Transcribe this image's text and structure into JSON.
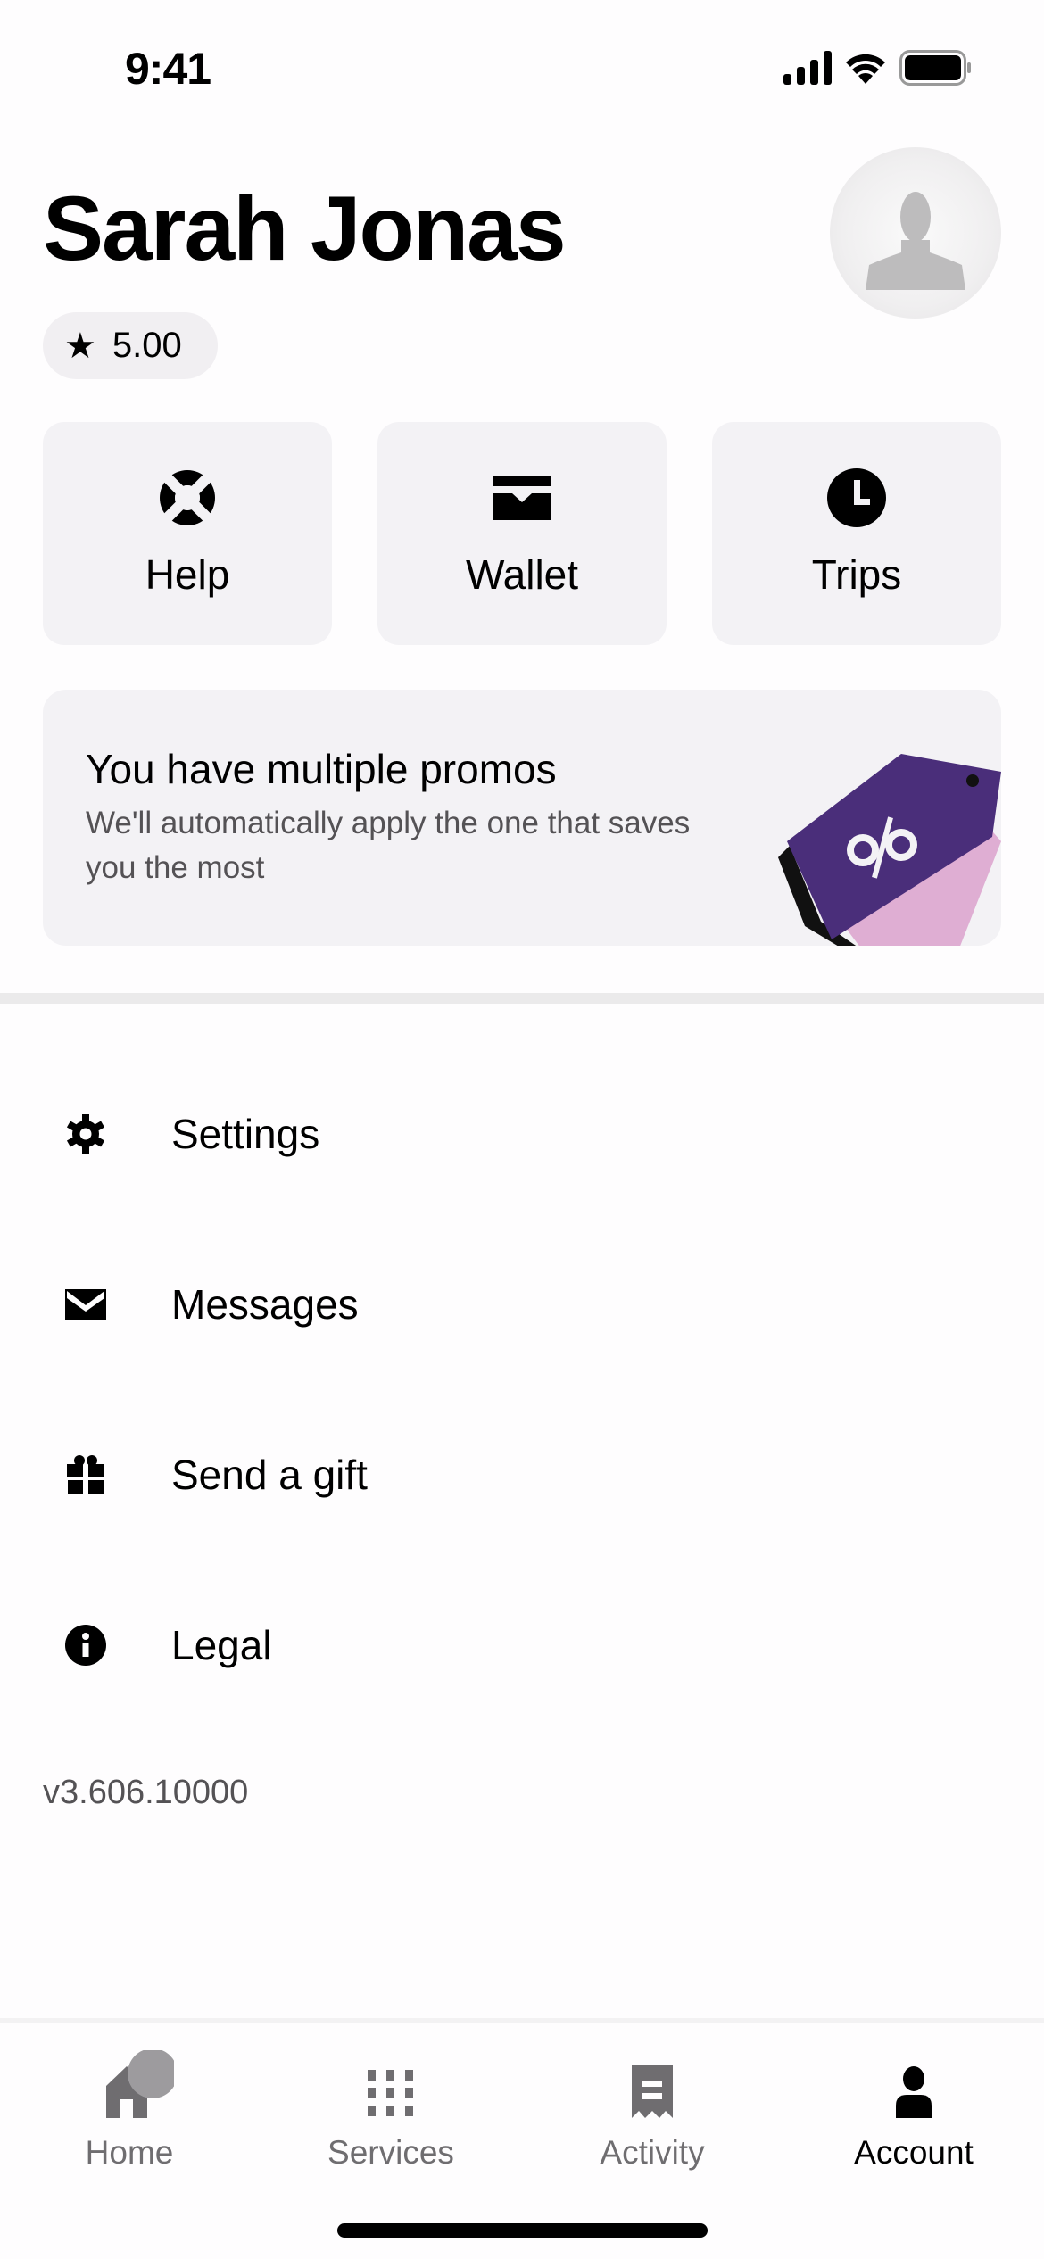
{
  "status_bar": {
    "time": "9:41",
    "icons": [
      "cellular-signal-icon",
      "wifi-icon",
      "battery-icon"
    ]
  },
  "profile": {
    "name": "Sarah Jonas",
    "rating": "5.00",
    "rating_icon": "star-icon",
    "avatar_icon": "person-silhouette-icon"
  },
  "quick_actions": [
    {
      "label": "Help",
      "icon": "lifebuoy-icon"
    },
    {
      "label": "Wallet",
      "icon": "wallet-icon"
    },
    {
      "label": "Trips",
      "icon": "clock-icon"
    }
  ],
  "promo": {
    "title": "You have multiple promos",
    "subtitle": "We'll automatically apply the one that saves you the most",
    "illustration": "percent-tag-illustration",
    "colors": {
      "tag_front": "#4a2e7a",
      "tag_back": "#dfaed3"
    }
  },
  "menu": [
    {
      "label": "Settings",
      "icon": "gear-icon"
    },
    {
      "label": "Messages",
      "icon": "envelope-icon"
    },
    {
      "label": "Send a gift",
      "icon": "gift-icon"
    },
    {
      "label": "Legal",
      "icon": "info-icon"
    }
  ],
  "version": "v3.606.10000",
  "bottom_nav": {
    "items": [
      {
        "label": "Home",
        "icon": "home-icon",
        "active": false
      },
      {
        "label": "Services",
        "icon": "grid-icon",
        "active": false
      },
      {
        "label": "Activity",
        "icon": "receipt-icon",
        "active": false
      },
      {
        "label": "Account",
        "icon": "person-icon",
        "active": true
      }
    ],
    "active_color": "#000000",
    "inactive_color": "#6f6d70"
  }
}
